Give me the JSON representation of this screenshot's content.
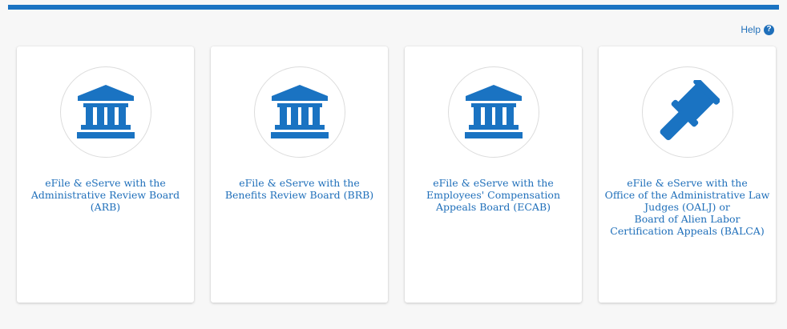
{
  "header": {
    "help_label": "Help",
    "help_icon": "question-circle-icon",
    "accent_color": "#1a73c2"
  },
  "cards": [
    {
      "icon": "courthouse-icon",
      "lines": [
        "eFile & eServe with the",
        "Administrative Review Board",
        "(ARB)"
      ]
    },
    {
      "icon": "courthouse-icon",
      "lines": [
        "eFile & eServe with the",
        "Benefits Review Board (BRB)"
      ]
    },
    {
      "icon": "courthouse-icon",
      "lines": [
        "eFile & eServe with the",
        "Employees' Compensation",
        "Appeals Board (ECAB)"
      ]
    },
    {
      "icon": "gavel-icon",
      "lines": [
        "eFile & eServe with the",
        "Office of the Administrative Law",
        "Judges (OALJ) or",
        "Board of Alien Labor",
        "Certification Appeals (BALCA)"
      ]
    }
  ]
}
